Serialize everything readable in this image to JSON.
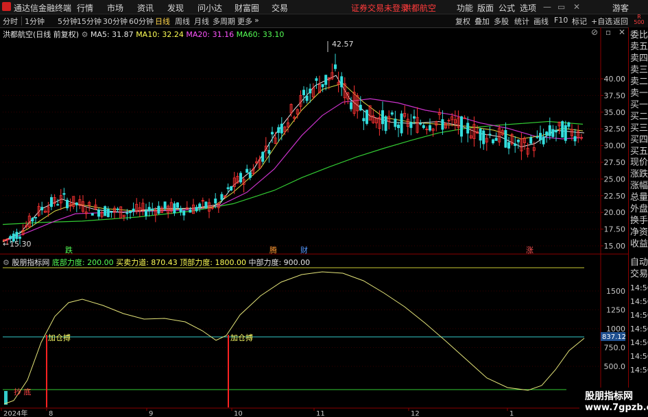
{
  "titlebar": {
    "app": "通达信金融终端",
    "menu": [
      "行情",
      "市场",
      "资讯",
      "发现",
      "问小达",
      "财富圈",
      "交易"
    ],
    "warning": "证券交易未登录",
    "stock": "洪都航空",
    "right_menu": [
      "功能",
      "版面",
      "公式",
      "选项"
    ],
    "guest": "游客"
  },
  "toolbar": {
    "periods": [
      "分时",
      "1分钟",
      "5分钟",
      "15分钟",
      "30分钟",
      "60分钟",
      "日线",
      "周线",
      "月线",
      "多周期",
      "更多"
    ],
    "active_period": "日线",
    "tools": [
      "复权",
      "叠加",
      "多股",
      "统计",
      "画线",
      "F10",
      "标记",
      "+自选",
      "返回"
    ],
    "corner": "R 500"
  },
  "main_chart": {
    "title": "洪都航空(日线 前复权)",
    "ma": [
      {
        "label": "MA5: 31.87",
        "color": "#e6e6e6"
      },
      {
        "label": "MA10: 32.24",
        "color": "#ffff55"
      },
      {
        "label": "MA20: 31.16",
        "color": "#ff55ff"
      },
      {
        "label": "MA60: 33.10",
        "color": "#55ff55"
      }
    ],
    "high_label": "42.57",
    "low_label": "15.30",
    "axis_ticks": [
      "40.00",
      "37.50",
      "35.00",
      "32.50",
      "30.00",
      "27.50",
      "25.00",
      "22.50",
      "20.00",
      "17.50",
      "15.00"
    ],
    "event_markers": [
      "跌",
      "腾",
      "财",
      "涨"
    ]
  },
  "indicator": {
    "name": "股朋指标网",
    "items": [
      {
        "label": "底部力度: 200.00",
        "color": "#55ff55"
      },
      {
        "label": "买卖力道: 870.43",
        "color": "#ffff55"
      },
      {
        "label": "顶部力度: 1800.00",
        "color": "#ffff55"
      },
      {
        "label": "中部力度: 900.00",
        "color": "#e6e6e6"
      }
    ],
    "axis_ticks": [
      "1500",
      "1250",
      "1000",
      "750.0",
      "500.0"
    ],
    "current_value": "837.12",
    "signals": [
      "加仓搏",
      "加仓搏"
    ],
    "bottom_signal": "抄 底"
  },
  "date_axis": [
    "2024年",
    "8",
    "9",
    "10",
    "11",
    "12",
    "1"
  ],
  "right_panel": [
    "委比",
    "卖五",
    "卖四",
    "卖三",
    "卖二",
    "卖一",
    "买一",
    "买二",
    "买三",
    "买四",
    "买五",
    "现价",
    "涨跌",
    "涨幅",
    "总量",
    "外盘",
    "换手",
    "净资",
    "收益",
    "自动",
    "交易",
    "14:56",
    "14:56",
    "14:56",
    "14:56",
    "14:56",
    "14:56",
    "14:56"
  ],
  "watermark": {
    "line1": "股朋指标网",
    "line2": "www.7gpzb.com"
  },
  "chart_data": {
    "type": "line",
    "x": [
      "2024-07",
      "2024-08",
      "2024-09",
      "2024-10",
      "2024-11",
      "2024-12",
      "2025-01"
    ],
    "series": [
      {
        "name": "MA5",
        "values": [
          15.6,
          21.5,
          20.5,
          25.5,
          39.5,
          33.0,
          31.9
        ]
      },
      {
        "name": "MA10",
        "values": [
          15.5,
          21.0,
          20.6,
          24.5,
          38.5,
          32.8,
          32.2
        ]
      },
      {
        "name": "MA20",
        "values": [
          15.8,
          19.5,
          20.5,
          23.0,
          36.5,
          33.5,
          31.2
        ]
      },
      {
        "name": "MA60",
        "values": [
          18.2,
          18.5,
          19.5,
          21.0,
          26.5,
          31.0,
          33.1
        ]
      },
      {
        "name": "买卖力道",
        "values": [
          20,
          1350,
          1150,
          1020,
          1780,
          950,
          870
        ]
      }
    ],
    "ylim": [
      15,
      42.57
    ]
  }
}
